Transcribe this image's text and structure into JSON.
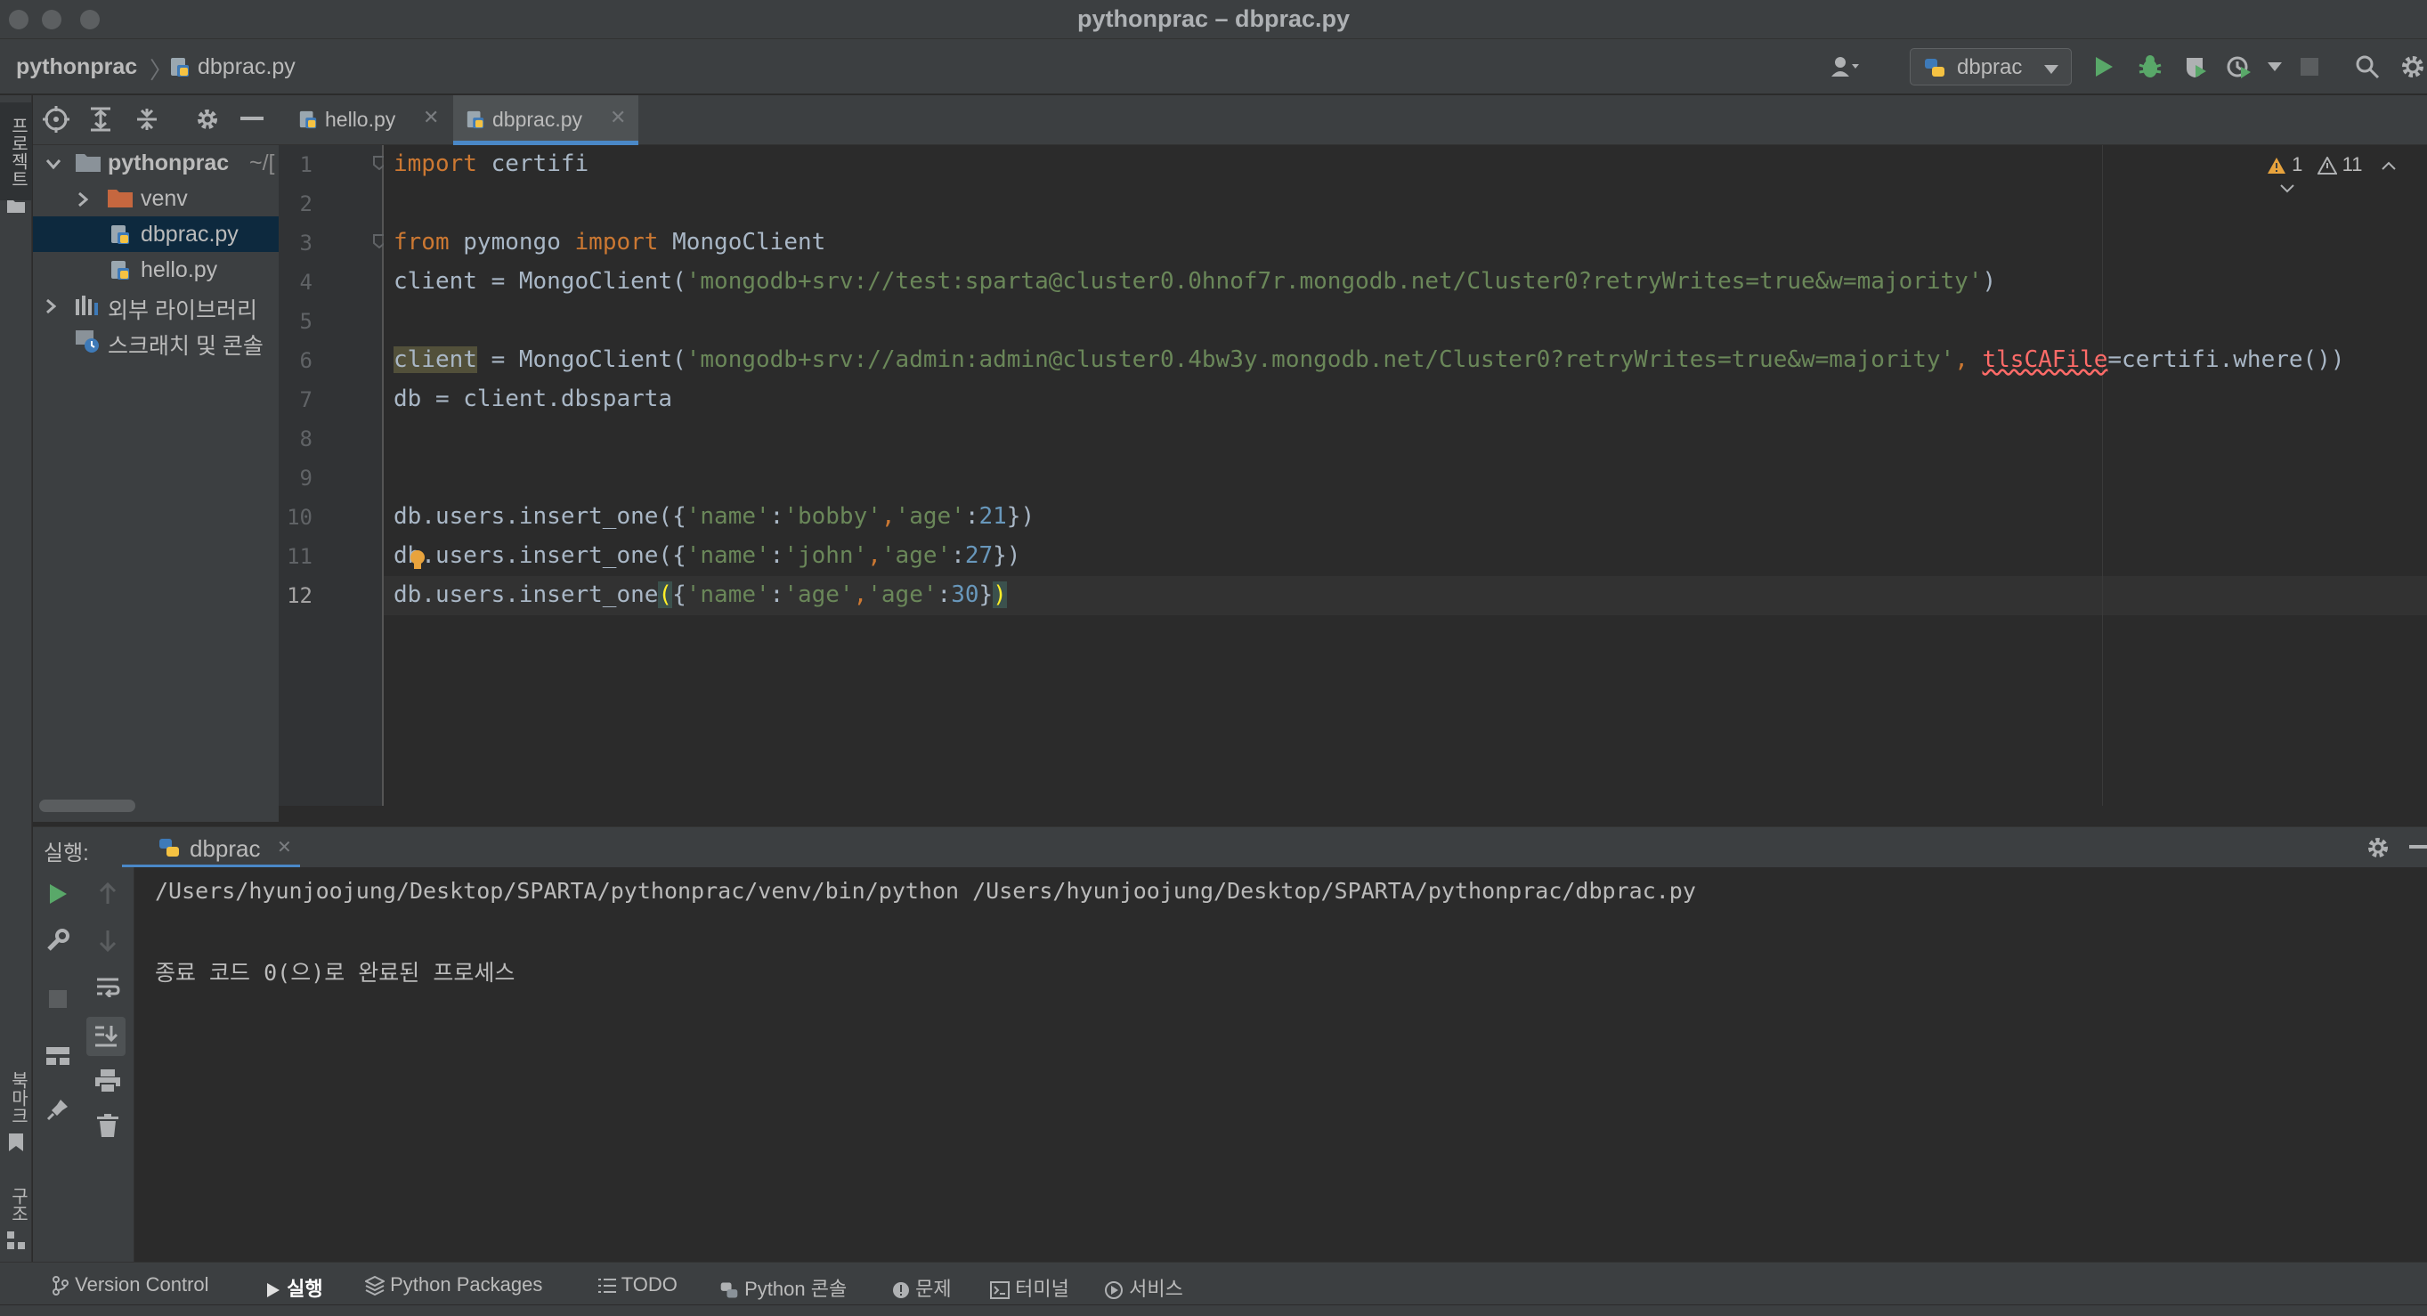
{
  "window": {
    "title": "pythonprac – dbprac.py"
  },
  "navbar": {
    "project": "pythonprac",
    "file": "dbprac.py",
    "run_config": "dbprac"
  },
  "left_strip": {
    "project_label": "프로젝트",
    "bookmarks_label": "북마크",
    "structure_label": "구조"
  },
  "project_tree": {
    "root_label": "pythonprac",
    "root_path": "~/[",
    "items": [
      {
        "label": "venv",
        "type": "folder"
      },
      {
        "label": "dbprac.py",
        "type": "python-file",
        "selected": true
      },
      {
        "label": "hello.py",
        "type": "python-file"
      },
      {
        "label": "외부 라이브러리",
        "type": "library"
      },
      {
        "label": "스크래치 및 콘솔",
        "type": "scratch"
      }
    ]
  },
  "editor": {
    "tabs": [
      {
        "label": "hello.py",
        "active": false
      },
      {
        "label": "dbprac.py",
        "active": true
      }
    ],
    "line_numbers": [
      "1",
      "2",
      "3",
      "4",
      "5",
      "6",
      "7",
      "8",
      "9",
      "10",
      "11",
      "12"
    ],
    "current_line": 12,
    "lines": {
      "l1_kw": "import",
      "l1_rest": " certifi",
      "l3_kw1": "from",
      "l3_mid": " pymongo ",
      "l3_kw2": "import",
      "l3_rest": " MongoClient",
      "l4_pre": "client = MongoClient(",
      "l4_str": "'mongodb+srv://test:sparta@cluster0.0hnof7r.mongodb.net/Cluster0?retryWrites=true&w=majority'",
      "l4_post": ")",
      "l6_var": "client",
      "l6_pre": " = MongoClient(",
      "l6_str": "'mongodb+srv://admin:admin@cluster0.4bw3y.mongodb.net/Cluster0?retryWrites=true&w=majority'",
      "l6_comma": ", ",
      "l6_param": "tlsCAFile",
      "l6_post": "=certifi.where())",
      "l7": "db = client.dbsparta",
      "l10_pre": "db.users.insert_one({",
      "l10_s1": "'name'",
      "l10_c1": ":",
      "l10_s2": "'bobby'",
      "l10_c2": ",",
      "l10_s3": "'age'",
      "l10_c3": ":",
      "l10_n": "21",
      "l10_post": "})",
      "l11_pre": "db.users.insert_one({",
      "l11_s1": "'name'",
      "l11_c1": ":",
      "l11_s2": "'john'",
      "l11_c2": ",",
      "l11_s3": "'age'",
      "l11_c3": ":",
      "l11_n": "27",
      "l11_post": "})",
      "l12_pre": "db.users.insert_one",
      "l12_paren": "(",
      "l12_brace": "{",
      "l12_s1": "'name'",
      "l12_c1": ":",
      "l12_s2": "'age'",
      "l12_c2": ",",
      "l12_s3": "'age'",
      "l12_c3": ":",
      "l12_n": "30",
      "l12_brace2": "}",
      "l12_paren2": ")"
    },
    "inspections": {
      "warnings": "1",
      "weak_warnings": "11"
    }
  },
  "run_panel": {
    "title": "실행:",
    "tab_label": "dbprac",
    "output": [
      "/Users/hyunjoojung/Desktop/SPARTA/pythonprac/venv/bin/python /Users/hyunjoojung/Desktop/SPARTA/pythonprac/dbprac.py",
      "종료 코드 0(으)로 완료된 프로세스"
    ]
  },
  "bottom_bar": {
    "items": [
      {
        "label": "Version Control",
        "icon": "vcs-branch-icon"
      },
      {
        "label": "실행",
        "icon": "run-icon",
        "active": true
      },
      {
        "label": "Python Packages",
        "icon": "packages-icon"
      },
      {
        "label": "TODO",
        "icon": "list-icon"
      },
      {
        "label": "Python 콘솔",
        "icon": "python-console-icon"
      },
      {
        "label": "문제",
        "icon": "problems-icon"
      },
      {
        "label": "터미널",
        "icon": "terminal-icon"
      },
      {
        "label": "서비스",
        "icon": "services-icon"
      }
    ]
  },
  "colors": {
    "keyword": "#cc7832",
    "string": "#6a8759",
    "number": "#6897bb",
    "run_green": "#59a869",
    "accent_blue": "#4a88c7",
    "error_red": "#ff6b68"
  }
}
